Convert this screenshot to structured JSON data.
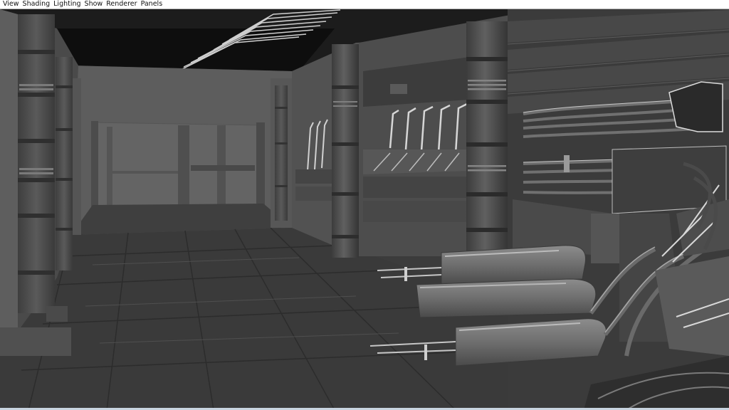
{
  "menubar": {
    "items": [
      {
        "label": "View"
      },
      {
        "label": "Shading"
      },
      {
        "label": "Lighting"
      },
      {
        "label": "Show"
      },
      {
        "label": "Renderer"
      },
      {
        "label": "Panels"
      }
    ]
  },
  "viewport": {
    "shading": "flat-shaded grey",
    "background_color": "#3c3c3c"
  }
}
